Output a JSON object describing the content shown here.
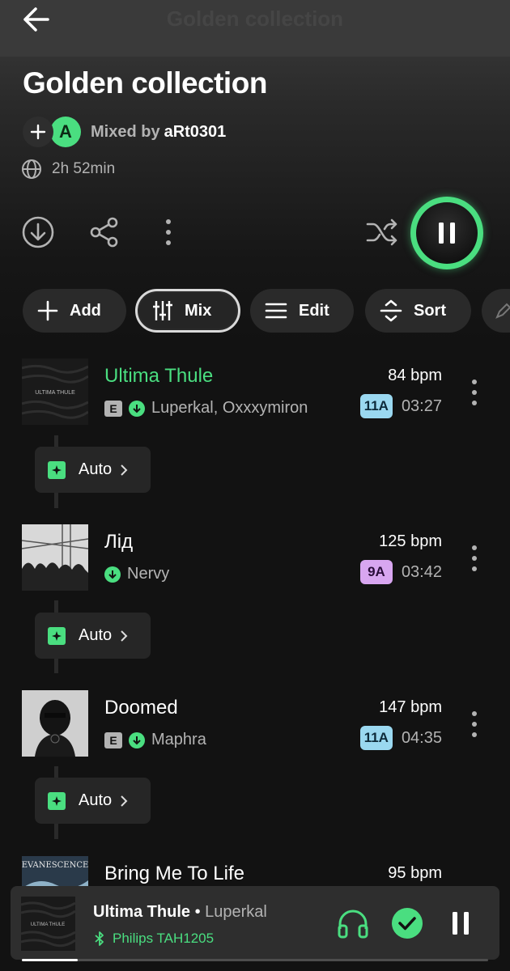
{
  "header": {
    "faded_title": "Golden collection"
  },
  "playlist": {
    "title": "Golden collection",
    "avatar_letter": "A",
    "mixed_by_label": "Mixed by",
    "mixed_by_user": "aRt0301",
    "duration": "2h 52min"
  },
  "chips": [
    {
      "label": "Add",
      "icon": "plus-icon"
    },
    {
      "label": "Mix",
      "icon": "sliders-icon",
      "selected": true
    },
    {
      "label": "Edit",
      "icon": "list-icon"
    },
    {
      "label": "Sort",
      "icon": "sort-icon"
    }
  ],
  "tracks": [
    {
      "title": "Ultima Thule",
      "title_color": "#4ade80",
      "explicit": true,
      "explicit_label": "E",
      "artists": "Luperkal, Oxxxymiron",
      "bpm": "84 bpm",
      "key": "11A",
      "key_color": "#9ad8f0",
      "duration": "03:27",
      "transition": "Auto"
    },
    {
      "title": "Лід",
      "title_color": "#ffffff",
      "explicit": false,
      "artists": "Nervy",
      "bpm": "125 bpm",
      "key": "9A",
      "key_color": "#d8a6f0",
      "duration": "03:42",
      "transition": "Auto"
    },
    {
      "title": "Doomed",
      "title_color": "#ffffff",
      "explicit": true,
      "explicit_label": "E",
      "artists": "Maphra",
      "bpm": "147 bpm",
      "key": "11A",
      "key_color": "#9ad8f0",
      "duration": "04:35",
      "transition": "Auto"
    },
    {
      "title": "Bring Me To Life",
      "title_color": "#ffffff",
      "bpm": "95 bpm"
    }
  ],
  "mini_player": {
    "title": "Ultima Thule",
    "separator": " • ",
    "artist": "Luperkal",
    "device": "Philips TAH1205",
    "progress": 0.12
  },
  "colors": {
    "accent": "#4ade80",
    "background": "#121212"
  }
}
